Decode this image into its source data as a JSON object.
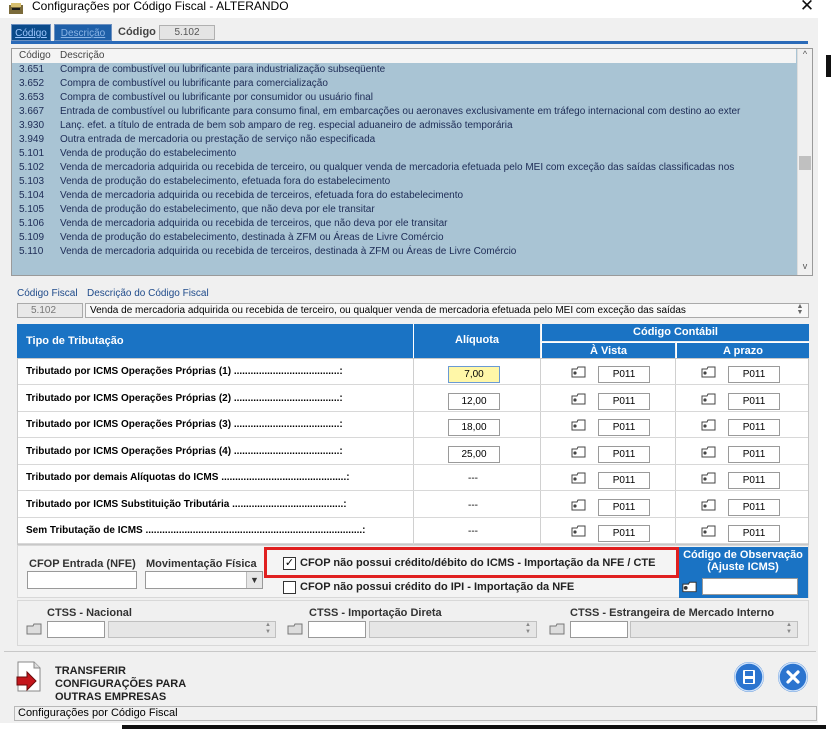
{
  "window": {
    "title": "Configurações por Código Fiscal  -  ALTERANDO"
  },
  "tabs": [
    {
      "label": "Código"
    },
    {
      "label": "Descrição"
    }
  ],
  "search": {
    "label": "Código",
    "value": "5.102"
  },
  "list": {
    "headers": {
      "code": "Código",
      "description": "Descrição"
    },
    "rows": [
      {
        "code": "3.651",
        "description": "Compra de combustível ou lubrificante para industrialização subseqüente"
      },
      {
        "code": "3.652",
        "description": "Compra de combustível ou lubrificante para comercialização"
      },
      {
        "code": "3.653",
        "description": "Compra de combustível ou lubrificante por consumidor ou usuário final"
      },
      {
        "code": "3.667",
        "description": "Entrada de combustível ou lubrificante para consumo final, em embarcações ou aeronaves exclusivamente em tráfego internacional com destino ao exter"
      },
      {
        "code": "3.930",
        "description": "Lanç. efet. a título de entrada de bem sob amparo de reg. especial aduaneiro de admissão temporária"
      },
      {
        "code": "3.949",
        "description": "Outra entrada de mercadoria ou prestação de serviço não especificada"
      },
      {
        "code": "5.101",
        "description": "Venda de produção do estabelecimento"
      },
      {
        "code": "5.102",
        "description": "Venda de mercadoria adquirida ou recebida de terceiro, ou qualquer venda de mercadoria efetuada pelo MEI com exceção das saídas classificadas nos"
      },
      {
        "code": "5.103",
        "description": "Venda de produção do estabelecimento, efetuada fora do estabelecimento"
      },
      {
        "code": "5.104",
        "description": "Venda de mercadoria adquirida ou recebida de terceiros, efetuada fora do estabelecimento"
      },
      {
        "code": "5.105",
        "description": "Venda de produção do estabelecimento, que não deva por ele transitar"
      },
      {
        "code": "5.106",
        "description": "Venda de mercadoria adquirida ou recebida de terceiros, que não deva por ele transitar"
      },
      {
        "code": "5.109",
        "description": "Venda de produção do estabelecimento, destinada à ZFM ou Áreas de Livre Comércio"
      },
      {
        "code": "5.110",
        "description": "Venda de mercadoria adquirida ou recebida de terceiros, destinada à ZFM ou Áreas de Livre Comércio"
      }
    ]
  },
  "fiscal": {
    "label_code": "Código Fiscal",
    "label_description": "Descrição do Código Fiscal",
    "code": "5.102",
    "description": "Venda de mercadoria adquirida ou recebida de terceiro, ou qualquer venda de mercadoria efetuada pelo MEI com exceção das saídas"
  },
  "table": {
    "headers": {
      "tipo": "Tipo de Tributação",
      "aliquota": "Alíquota",
      "codigo_contabil": "Código Contábil",
      "a_vista": "À Vista",
      "a_prazo": "A prazo"
    },
    "rows": [
      {
        "label": "Tributado por ICMS Operações Próprias (1) ......................................:",
        "aliquota": "7,00",
        "a_vista": "P011",
        "a_prazo": "P011"
      },
      {
        "label": "Tributado por ICMS Operações Próprias (2) ......................................:",
        "aliquota": "12,00",
        "a_vista": "P011",
        "a_prazo": "P011"
      },
      {
        "label": "Tributado por ICMS Operações Próprias (3) ......................................:",
        "aliquota": "18,00",
        "a_vista": "P011",
        "a_prazo": "P011"
      },
      {
        "label": "Tributado por ICMS Operações Próprias (4) ......................................:",
        "aliquota": "25,00",
        "a_vista": "P011",
        "a_prazo": "P011"
      },
      {
        "label": "Tributado por demais Alíquotas do ICMS .............................................:",
        "aliquota": "---",
        "a_vista": "P011",
        "a_prazo": "P011"
      },
      {
        "label": "Tributado por ICMS Substituição Tributária ........................................:",
        "aliquota": "---",
        "a_vista": "P011",
        "a_prazo": "P011"
      },
      {
        "label": "Sem Tributação de ICMS ..............................................................................:",
        "aliquota": "---",
        "a_vista": "P011",
        "a_prazo": "P011"
      }
    ]
  },
  "lower": {
    "cfop_entrada_label": "CFOP Entrada (NFE)",
    "cfop_entrada_value": "",
    "movimentacao_label": "Movimentação Física",
    "movimentacao_value": "",
    "checkbox1": {
      "label": "CFOP não possui crédito/débito do ICMS -  Importação da NFE / CTE",
      "checked": true,
      "mark": "✓"
    },
    "checkbox2": {
      "label": "CFOP não possui crédito do IPI - Importação da NFE",
      "checked": false
    },
    "obs_title": "Código de Observação (Ajuste ICMS)",
    "obs_value": "",
    "highlight_color": "#e02020"
  },
  "ctss": {
    "nacional": "CTSS - Nacional",
    "importacao": "CTSS - Importação Direta",
    "estrangeira": "CTSS - Estrangeira de Mercado Interno"
  },
  "footer": {
    "transfer_label": "TRANSFERIR CONFIGURAÇÕES PARA OUTRAS EMPRESAS",
    "status": "Configurações por Código Fiscal"
  },
  "colors": {
    "header_blue": "#1a73c4",
    "list_bg": "#a9c4d4",
    "accent": "#2b74cf"
  },
  "icons": [
    "app-icon",
    "close-icon",
    "folder-icon",
    "arrow-right-icon",
    "save-icon",
    "exit-icon",
    "scroll-up-icon",
    "scroll-down-icon"
  ]
}
